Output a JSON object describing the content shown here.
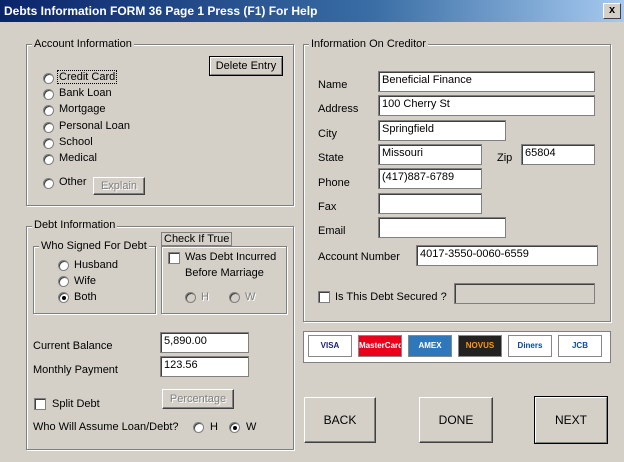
{
  "window": {
    "title": "Debts Information FORM  36  Page 1  Press (F1) For Help",
    "close_label": "x"
  },
  "account": {
    "legend": "Account Information",
    "delete_label": "Delete Entry",
    "types": [
      "Credit Card",
      "Bank Loan",
      "Mortgage",
      "Personal Loan",
      "School",
      "Medical"
    ],
    "other_label": "Other",
    "explain_label": "Explain"
  },
  "debt": {
    "legend": "Debt Information",
    "signed_legend": "Who Signed For Debt",
    "signers": [
      "Husband",
      "Wife",
      "Both"
    ],
    "selected_signer": "Both",
    "check_legend": "Check If True",
    "marriage_label_1": "Was Debt Incurred",
    "marriage_label_2": "Before Marriage",
    "h_label": "H",
    "w_label": "W",
    "balance_label": "Current Balance",
    "balance_value": "5,890.00",
    "payment_label": "Monthly Payment",
    "payment_value": "123.56",
    "split_label": "Split Debt",
    "percentage_label": "Percentage",
    "assume_label": "Who Will Assume Loan/Debt?",
    "assume_h": "H",
    "assume_w": "W",
    "assume_selected": "W"
  },
  "creditor": {
    "legend": "Information On Creditor",
    "name_label": "Name",
    "name": "Beneficial Finance",
    "address_label": "Address",
    "address": "100 Cherry St",
    "city_label": "City",
    "city": "Springfield",
    "state_label": "State",
    "state": "Missouri",
    "zip_label": "Zip",
    "zip": "65804",
    "phone_label": "Phone",
    "phone": "(417)887-6789",
    "fax_label": "Fax",
    "fax": "",
    "email_label": "Email",
    "email": "",
    "account_label": "Account Number",
    "account_number": "4017-3550-0060-6559",
    "secured_label": "Is This Debt Secured ?"
  },
  "cards": [
    {
      "name": "visa-logo",
      "text": "VISA",
      "bg": "#ffffff",
      "fg": "#1a1f71"
    },
    {
      "name": "mastercard-logo",
      "text": "MasterCard",
      "bg": "#eb001b",
      "fg": "#ffffff"
    },
    {
      "name": "amex-logo",
      "text": "AMEX",
      "bg": "#2e77bb",
      "fg": "#ffffff"
    },
    {
      "name": "discover-logo",
      "text": "NOVUS",
      "bg": "#222222",
      "fg": "#ff9900"
    },
    {
      "name": "diners-logo",
      "text": "Diners",
      "bg": "#ffffff",
      "fg": "#004a97"
    },
    {
      "name": "jcb-logo",
      "text": "JCB",
      "bg": "#ffffff",
      "fg": "#0b4ea2"
    }
  ],
  "buttons": {
    "back": "BACK",
    "done": "DONE",
    "next": "NEXT"
  }
}
